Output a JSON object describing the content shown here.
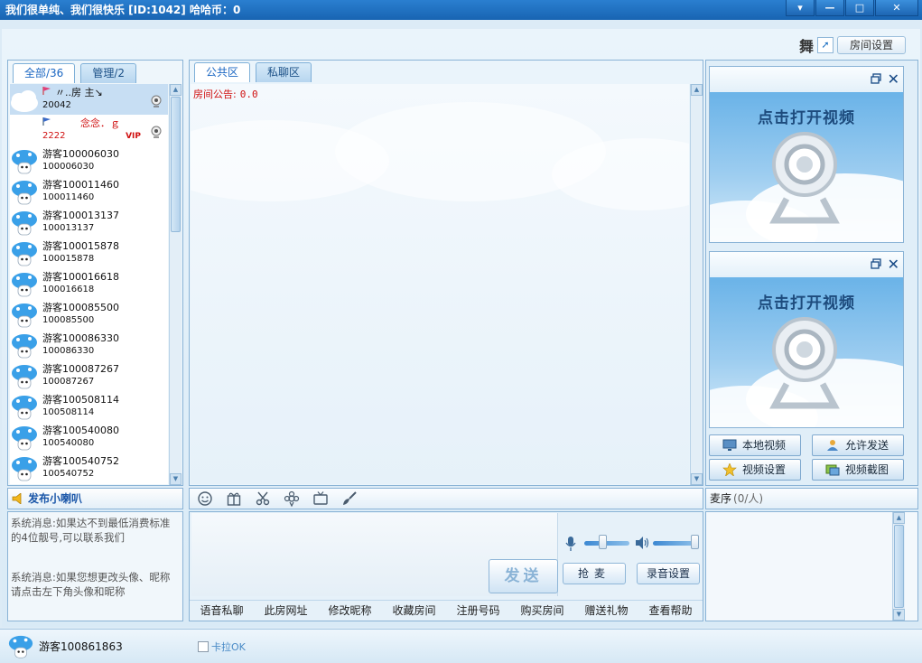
{
  "window": {
    "title": "我们很单纯、我们很快乐  [ID:1042]  哈哈币：0",
    "controls": [
      "▾",
      "—",
      "□",
      "✕"
    ]
  },
  "top_tools": {
    "dance_glyph": "舞",
    "room_settings": "房间设置"
  },
  "left": {
    "tabs": [
      {
        "label": "全部/36"
      },
      {
        "label": "管理/2"
      }
    ],
    "users": [
      {
        "name": "〃..房  主↘",
        "id": "20042",
        "type": "host"
      },
      {
        "name": "念念．ｇ",
        "id": "2222",
        "type": "mgr",
        "badge": "VIP"
      },
      {
        "name": "游客100006030",
        "id": "100006030"
      },
      {
        "name": "游客100011460",
        "id": "100011460"
      },
      {
        "name": "游客100013137",
        "id": "100013137"
      },
      {
        "name": "游客100015878",
        "id": "100015878"
      },
      {
        "name": "游客100016618",
        "id": "100016618"
      },
      {
        "name": "游客100085500",
        "id": "100085500"
      },
      {
        "name": "游客100086330",
        "id": "100086330"
      },
      {
        "name": "游客100087267",
        "id": "100087267"
      },
      {
        "name": "游客100508114",
        "id": "100508114"
      },
      {
        "name": "游客100540080",
        "id": "100540080"
      },
      {
        "name": "游客100540752",
        "id": "100540752"
      }
    ],
    "horn_label": "发布小喇叭",
    "system_messages": [
      "系统消息:如果达不到最低消费标准的4位靓号,可以联系我们",
      "系统消息:如果您想更改头像、昵称请点击左下角头像和昵称"
    ]
  },
  "chat": {
    "tabs": [
      {
        "label": "公共区"
      },
      {
        "label": "私聊区"
      }
    ],
    "notice_label": "房间公告:",
    "notice_value": "0.0",
    "send_label": "发送",
    "grab_mic_label": "抢麦",
    "record_settings_label": "录音设置",
    "mic_volume": 0.4,
    "speaker_volume": 0.95,
    "links": [
      "语音私聊",
      "此房网址",
      "修改昵称",
      "收藏房间",
      "注册号码",
      "购买房间",
      "赠送礼物",
      "查看帮助"
    ]
  },
  "video": {
    "prompt": "点击打开视频",
    "buttons": [
      {
        "label": "本地视频",
        "icon": "monitor-icon"
      },
      {
        "label": "允许发送",
        "icon": "users-icon"
      },
      {
        "label": "视频设置",
        "icon": "star-icon"
      },
      {
        "label": "视频截图",
        "icon": "screenshot-icon"
      }
    ]
  },
  "mic_queue": {
    "label": "麦序",
    "count": "(0/人)"
  },
  "status": {
    "me_name": "游客100861863",
    "karaoke_label": "卡拉OK"
  }
}
